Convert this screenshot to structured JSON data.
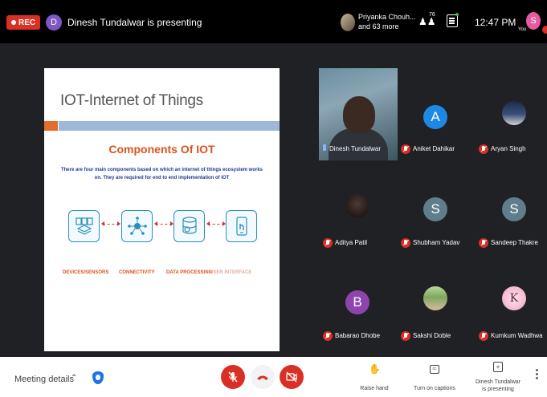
{
  "topbar": {
    "rec_label": "REC",
    "presenter_initial": "D",
    "presenter_text": "Dinesh Tundalwar is presenting",
    "pinned_line1": "Priyanka Chouh...",
    "pinned_line2": "and 63 more",
    "people_count": "76",
    "time": "12:47 PM",
    "self_initial": "S",
    "self_label": "You"
  },
  "slide": {
    "title": "IOT-Internet of Things",
    "heading": "Components Of IOT",
    "description": "There are four main components based on which an internet of things ecosystem works on. They are required for end to end implementation of IOT",
    "components": [
      {
        "label": "DEVICES/SENSORS",
        "icon": "sensor-icon"
      },
      {
        "label": "CONNECTIVITY",
        "icon": "cloud-network-icon"
      },
      {
        "label": "DATA PROCESSING",
        "icon": "database-gear-icon"
      },
      {
        "label": "USER INTERFACE",
        "icon": "phone-touch-icon"
      }
    ]
  },
  "participants": [
    {
      "name": "Dinesh Tundalwar",
      "type": "video"
    },
    {
      "name": "Aniket Dahikar",
      "initial": "A",
      "color": "#1e88e5"
    },
    {
      "name": "Aryan Singh",
      "type": "photo"
    },
    {
      "name": "Aditya Patil",
      "type": "photo"
    },
    {
      "name": "Shubham Yadav",
      "initial": "S",
      "color": "#607d8b"
    },
    {
      "name": "Sandeep Thakre",
      "initial": "S",
      "color": "#607d8b"
    },
    {
      "name": "Babarao Dhobe",
      "initial": "B",
      "color": "#8e44ad"
    },
    {
      "name": "Sakshi Doble",
      "type": "photo"
    },
    {
      "name": "Kumkum Wadhwa",
      "type": "photo",
      "initial": "K"
    }
  ],
  "bottombar": {
    "meeting_details": "Meeting details",
    "raise_hand": "Raise hand",
    "captions": "Turn on captions",
    "present_line1": "Dinesh Tundalwar",
    "present_line2": "is presenting"
  }
}
